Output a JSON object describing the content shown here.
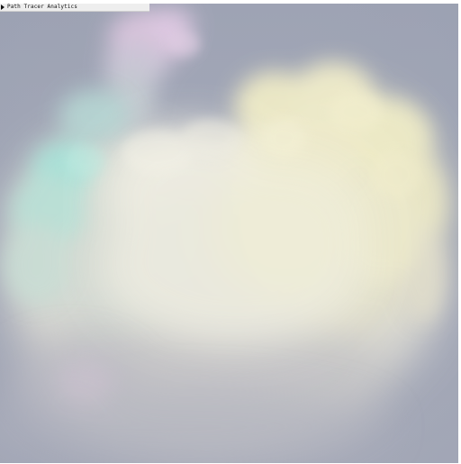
{
  "panel": {
    "title": "Path Tracer Analytics",
    "collapsed": true,
    "toggle_icon": "triangle-right-icon"
  },
  "scene": {
    "sky_color": "#a3a8b7",
    "cloud_colors": {
      "warm_yellow": "#eeeac8",
      "cool_cyan": "#b6e6dc",
      "pink": "#e0c8e4",
      "white": "#f1efe6"
    }
  }
}
